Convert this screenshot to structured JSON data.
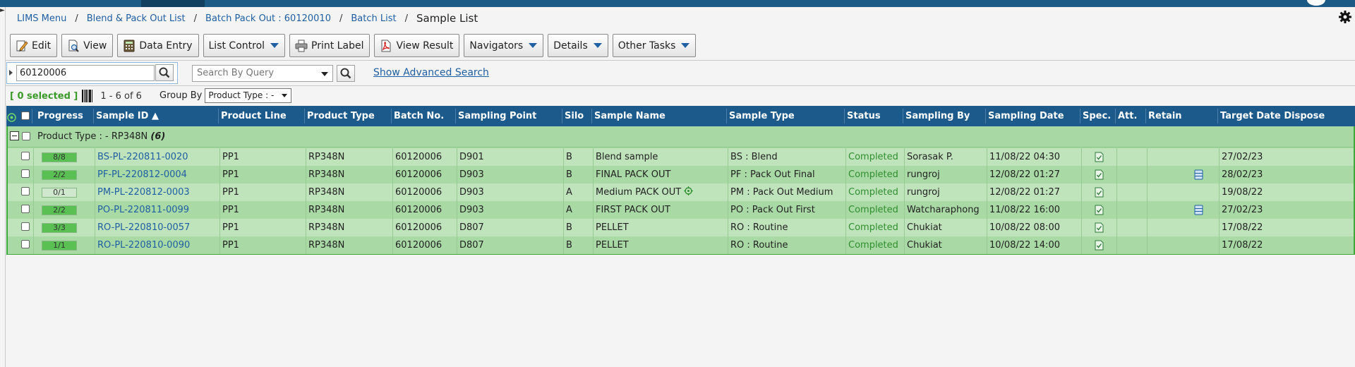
{
  "breadcrumb": {
    "items": [
      "LIMS Menu",
      "Blend & Pack Out List",
      "Batch Pack Out : 60120010",
      "Batch List"
    ],
    "separator": "/",
    "current": "Sample List"
  },
  "toolbar": {
    "edit": "Edit",
    "view": "View",
    "data_entry": "Data Entry",
    "list_control": "List Control",
    "print_label": "Print Label",
    "view_result": "View Result",
    "navigators": "Navigators",
    "details": "Details",
    "other_tasks": "Other Tasks"
  },
  "search": {
    "value": "60120006",
    "query_placeholder": "Search By Query",
    "advanced_link": "Show Advanced Search"
  },
  "selection": {
    "selected_text": "[ 0 selected ]",
    "count_text": "1 - 6 of 6",
    "group_by_label": "Group By",
    "group_by_value": "Product Type : -"
  },
  "grid": {
    "columns": {
      "progress": "Progress",
      "sample_id": "Sample ID",
      "product_line": "Product Line",
      "product_type": "Product Type",
      "batch_no": "Batch No.",
      "sampling_point": "Sampling Point",
      "silo": "Silo",
      "sample_name": "Sample Name",
      "sample_type": "Sample Type",
      "status": "Status",
      "sampling_by": "Sampling By",
      "sampling_date": "Sampling Date",
      "spec": "Spec.",
      "att": "Att.",
      "retain": "Retain",
      "target_date": "Target Date Dispose"
    },
    "group": {
      "label": "Product Type : - RP348N",
      "count": "(6)"
    },
    "rows": [
      {
        "progress": "8/8",
        "fill": 1.0,
        "sample_id": "BS-PL-220811-0020",
        "product_line": "PP1",
        "product_type": "RP348N",
        "batch_no": "60120006",
        "sampling_point": "D901",
        "silo": "B",
        "sample_name": "Blend sample",
        "sample_type": "BS : Blend",
        "status": "Completed",
        "sampling_by": "Sorasak P.",
        "sampling_date": "11/08/22 04:30",
        "has_spec": true,
        "has_retain": false,
        "target_date": "27/02/23"
      },
      {
        "progress": "2/2",
        "fill": 1.0,
        "sample_id": "PF-PL-220812-0004",
        "product_line": "PP1",
        "product_type": "RP348N",
        "batch_no": "60120006",
        "sampling_point": "D903",
        "silo": "B",
        "sample_name": "FINAL PACK OUT",
        "sample_type": "PF : Pack Out Final",
        "status": "Completed",
        "sampling_by": "rungroj",
        "sampling_date": "12/08/22 01:27",
        "has_spec": true,
        "has_retain": true,
        "target_date": "28/02/23"
      },
      {
        "progress": "0/1",
        "fill": 0.0,
        "sample_id": "PM-PL-220812-0003",
        "product_line": "PP1",
        "product_type": "RP348N",
        "batch_no": "60120006",
        "sampling_point": "D903",
        "silo": "A",
        "sample_name": "Medium PACK OUT",
        "has_target": true,
        "sample_type": "PM : Pack Out Medium",
        "status": "Completed",
        "sampling_by": "rungroj",
        "sampling_date": "12/08/22 01:27",
        "has_spec": true,
        "has_retain": false,
        "target_date": "19/08/22"
      },
      {
        "progress": "2/2",
        "fill": 1.0,
        "sample_id": "PO-PL-220811-0099",
        "product_line": "PP1",
        "product_type": "RP348N",
        "batch_no": "60120006",
        "sampling_point": "D903",
        "silo": "A",
        "sample_name": "FIRST PACK OUT",
        "sample_type": "PO : Pack Out First",
        "status": "Completed",
        "sampling_by": "Watcharaphong",
        "sampling_date": "11/08/22 16:00",
        "has_spec": true,
        "has_retain": true,
        "target_date": "27/02/23"
      },
      {
        "progress": "3/3",
        "fill": 1.0,
        "sample_id": "RO-PL-220810-0057",
        "product_line": "PP1",
        "product_type": "RP348N",
        "batch_no": "60120006",
        "sampling_point": "D807",
        "silo": "B",
        "sample_name": "PELLET",
        "sample_type": "RO : Routine",
        "status": "Completed",
        "sampling_by": "Chukiat",
        "sampling_date": "10/08/22 08:00",
        "has_spec": true,
        "has_retain": false,
        "target_date": "17/08/22"
      },
      {
        "progress": "1/1",
        "fill": 1.0,
        "sample_id": "RO-PL-220810-0090",
        "product_line": "PP1",
        "product_type": "RP348N",
        "batch_no": "60120006",
        "sampling_point": "D807",
        "silo": "B",
        "sample_name": "PELLET",
        "sample_type": "RO : Routine",
        "status": "Completed",
        "sampling_by": "Chukiat",
        "sampling_date": "10/08/22 14:00",
        "has_spec": true,
        "has_retain": false,
        "target_date": "17/08/22"
      }
    ]
  },
  "colors": {
    "header_bg": "#1c5a8c",
    "group_bg": "#a8d8a4",
    "row_light": "#bfe3bb",
    "row_dark": "#a9d9a4",
    "link": "#1f5fa3",
    "status_completed": "#2f8f2f",
    "progress_fill": "#5ac054"
  },
  "icons": {
    "edit": "pencil-edit-icon",
    "view": "view-document-icon",
    "data_entry": "calculator-icon",
    "print_label": "printer-icon",
    "view_result": "pdf-icon",
    "search": "magnifier-icon",
    "settings": "gear-icon",
    "barcode": "barcode-icon",
    "spec": "spec-document-icon",
    "retain": "retain-storage-icon",
    "target": "target-icon",
    "sort": "sort-ascending-icon"
  }
}
